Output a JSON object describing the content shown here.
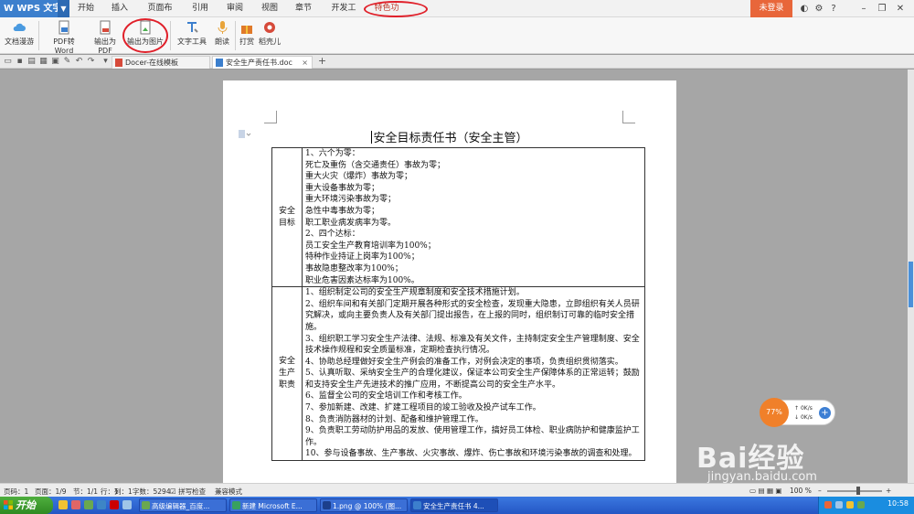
{
  "app": {
    "name": "WPS 文字"
  },
  "menu": {
    "items": [
      "开始",
      "插入",
      "页面布局",
      "引用",
      "审阅",
      "视图",
      "章节",
      "开发工具",
      "特色功能"
    ],
    "active": "特色功能",
    "login": "未登录"
  },
  "ribbon": {
    "buttons": [
      "文档漫游",
      "PDF转Word",
      "输出为PDF",
      "输出为图片",
      "文字工具",
      "朗读",
      "打赏",
      "稻壳儿"
    ]
  },
  "tabs": {
    "items": [
      "Docer-在线模板",
      "安全生产责任书.doc"
    ],
    "new_tab": "+"
  },
  "document": {
    "title": "安全目标责任书（安全主管）",
    "section1_label": [
      "安全",
      "目标"
    ],
    "section1_lines": [
      "1、六个为零：",
      "死亡及重伤（含交通责任）事故为零；",
      "重大火灾（爆炸）事故为零；",
      "重大设备事故为零；",
      "重大环境污染事故为零；",
      "急性中毒事故为零；",
      "职工职业病发病率为零。",
      "2、四个达标：",
      "员工安全生产教育培训率为100%；",
      "特种作业持证上岗率为100%；",
      "事故隐患整改率为100%；",
      "职业危害因素达标率为100%。"
    ],
    "section2_label": [
      "安全",
      "生产",
      "职责"
    ],
    "section2_paras": [
      "1、组织制定公司的安全生产规章制度和安全技术措施计划。",
      "2、组织车间和有关部门定期开展各种形式的安全检查，发现重大隐患，立即组织有关人员研究解决，或向主要负责人及有关部门提出报告，在上报的同时，组织制订可靠的临时安全措施。",
      "3、组织职工学习安全生产法律、法规、标准及有关文件，主持制定安全生产管理制度、安全技术操作规程和安全质量标准，定期检查执行情况。",
      "4、协助总经理做好安全生产例会的准备工作，对例会决定的事项，负责组织贯彻落实。",
      "5、认真听取、采纳安全生产的合理化建议，保证本公司安全生产保障体系的正常运转；鼓励和支持安全生产先进技术的推广应用，不断提高公司的安全生产水平。",
      "6、监督全公司的安全培训工作和考核工作。",
      "7、参加新建、改建、扩建工程项目的竣工验收及投产试车工作。",
      "8、负责消防器材的计划、配备和维护管理工作。",
      "9、负责职工劳动防护用品的发放、使用管理工作，搞好员工体检、职业病防护和健康监护工作。",
      "10、参与设备事故、生产事故、火灾事故、爆炸、伤亡事故和环境污染事故的调查和处理。"
    ]
  },
  "speed_widget": {
    "percent": "77%",
    "up": "0K/s",
    "down": "0K/s"
  },
  "watermark": {
    "brand": "Bai经验",
    "url": "jingyan.baidu.com"
  },
  "status": {
    "page": "页码：1",
    "pages": "页面：1/9",
    "section": "节：1/1",
    "row": "行：1",
    "col": "列：1",
    "words": "字数：5294",
    "spell": "拼写检查",
    "mode": "兼容模式",
    "zoom": "100 %"
  },
  "taskbar": {
    "start": "开始",
    "tasks": [
      "高级编辑器_百度...",
      "新建 Microsoft E...",
      "1.png @ 100% (图...",
      "安全生产责任书 4..."
    ],
    "clock": "10:58"
  },
  "colors": {
    "wps_blue": "#3c7fcd",
    "login_orange": "#e8663a",
    "highlight_red": "#e0202a",
    "xp_start_green": "#3c9a2e"
  }
}
